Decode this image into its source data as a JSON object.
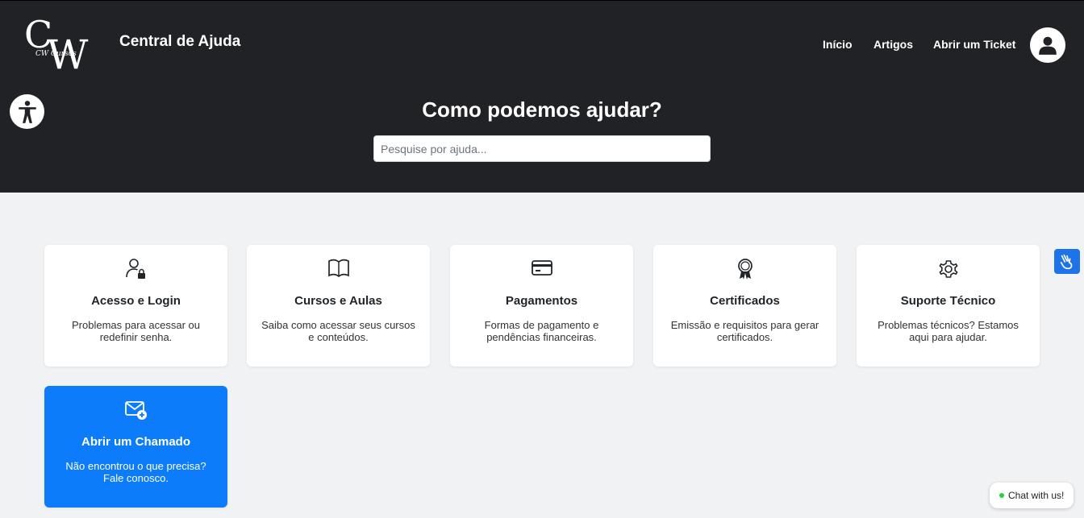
{
  "header": {
    "logo_text": "CW Cursos",
    "title": "Central de Ajuda",
    "nav": [
      {
        "label": "Início"
      },
      {
        "label": "Artigos"
      },
      {
        "label": "Abrir um Ticket"
      }
    ],
    "avatar_icon": "user-icon"
  },
  "hero": {
    "title": "Como podemos ajudar?",
    "search_placeholder": "Pesquise por ajuda...",
    "search_value": ""
  },
  "cards": [
    {
      "icon": "user-lock-icon",
      "title": "Acesso e Login",
      "desc": "Problemas para acessar ou redefinir senha."
    },
    {
      "icon": "book-icon",
      "title": "Cursos e Aulas",
      "desc": "Saiba como acessar seus cursos e conteúdos."
    },
    {
      "icon": "credit-card-icon",
      "title": "Pagamentos",
      "desc": "Formas de pagamento e pendências financeiras."
    },
    {
      "icon": "award-icon",
      "title": "Certificados",
      "desc": "Emissão e requisitos para gerar certificados."
    },
    {
      "icon": "gear-icon",
      "title": "Suporte Técnico",
      "desc": "Problemas técnicos? Estamos aqui para ajudar."
    },
    {
      "icon": "envelope-plus-icon",
      "title": "Abrir um Chamado",
      "desc": "Não encontrou o que precisa? Fale conosco."
    }
  ],
  "widgets": {
    "chat_label": "Chat with us!",
    "chat_status_color": "#2ecc40",
    "vlibras_color": "#1e73e8",
    "primary_color": "#0d7cfb",
    "hero_color": "#212226"
  }
}
